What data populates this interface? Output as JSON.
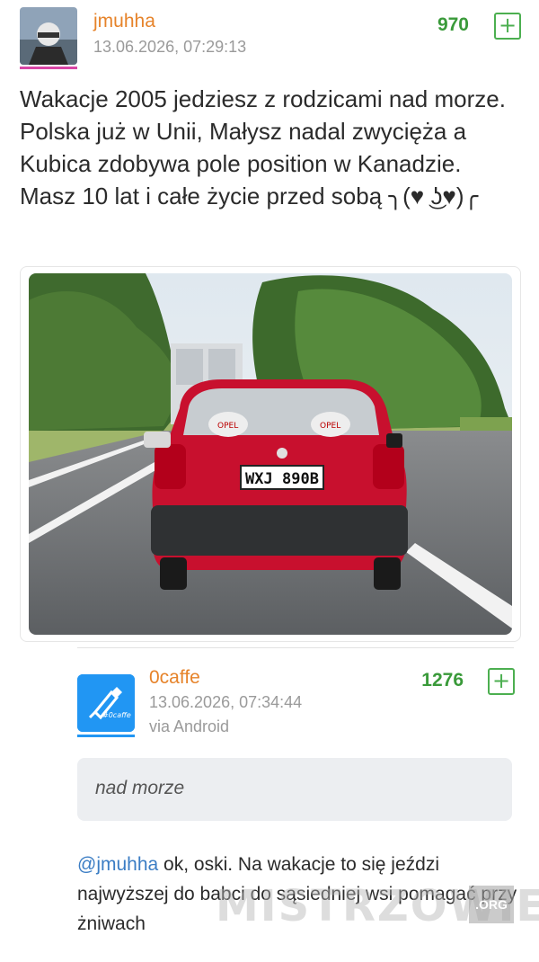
{
  "post": {
    "username": "jmuhha",
    "timestamp": "13.06.2026, 07:29:13",
    "votes": "970",
    "plus": "+",
    "text": "Wakacje 2005 jedziesz z rodzicami nad morze. Polska już w Unii, Małysz nadal zwycięża a Kubica zdobywa pole position w Kanadzie. Masz 10 lat i całe życie przed sobą ╮(♥ ͜ʖ♥)╭",
    "photo": {
      "plate": "WXJ 890B",
      "headrest_left": "OPEL",
      "headrest_right": "OPEL"
    }
  },
  "comment": {
    "username": "0caffe",
    "avatar_text": "#0caffe",
    "timestamp": "13.06.2026, 07:34:44",
    "via": "via Android",
    "votes": "1276",
    "plus": "+",
    "quote": "nad morze",
    "mention": "@jmuhha",
    "reply_text": " ok, oski. Na wakacje to się jeździ najwyższej do babci do sąsiedniej wsi pomagać przy żniwach"
  },
  "watermark": {
    "text": "MISTRZOWIE",
    "org": ".ORG"
  },
  "colors": {
    "username": "#e6832a",
    "votes": "#3a9a3a",
    "mention": "#3b7dc4",
    "avatar_accent": "#d946a6",
    "avatar2_bg": "#2196f3"
  }
}
